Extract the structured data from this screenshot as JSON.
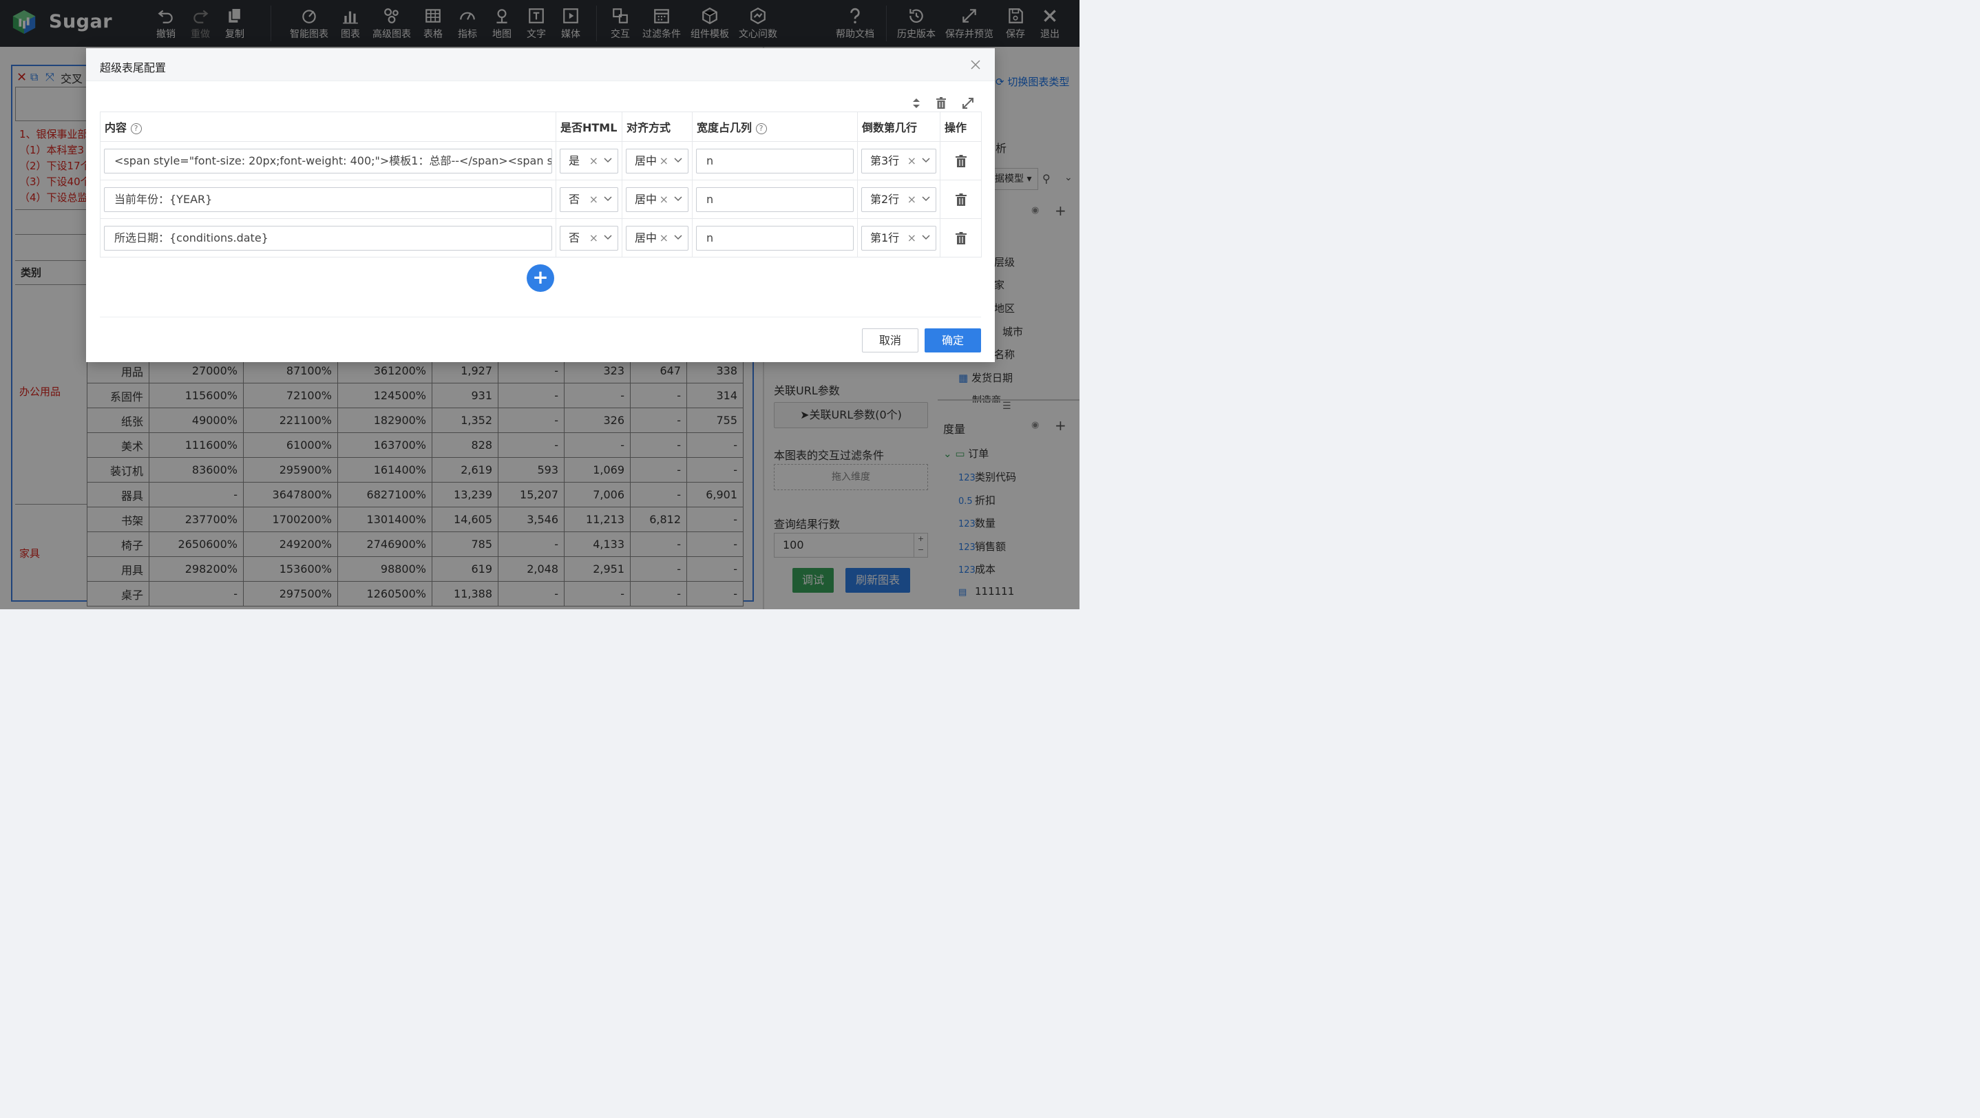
{
  "app": {
    "name": "Sugar"
  },
  "toolbar": {
    "items": [
      {
        "label": "撤销"
      },
      {
        "label": "重做"
      },
      {
        "label": "复制"
      },
      {
        "label": "智能图表"
      },
      {
        "label": "图表"
      },
      {
        "label": "高级图表"
      },
      {
        "label": "表格"
      },
      {
        "label": "指标"
      },
      {
        "label": "地图"
      },
      {
        "label": "文字"
      },
      {
        "label": "媒体"
      },
      {
        "label": "交互"
      },
      {
        "label": "过滤条件"
      },
      {
        "label": "组件模板"
      },
      {
        "label": "文心问数"
      },
      {
        "label": "帮助文档"
      },
      {
        "label": "历史版本"
      },
      {
        "label": "保存并预览"
      },
      {
        "label": "保存"
      },
      {
        "label": "退出"
      }
    ]
  },
  "background": {
    "panel_title": "交叉",
    "left_notes": [
      "1、银保事业部",
      "（1）本科室3",
      "（2）下设17个",
      "（3）下设40个",
      "（4）下设总监"
    ],
    "category_header": "类别",
    "categories": [
      "办公用品",
      "家具"
    ],
    "table": {
      "rows": [
        [
          "用品",
          "27000%",
          "87100%",
          "361200%",
          "1,927",
          "-",
          "323",
          "647",
          "338"
        ],
        [
          "系固件",
          "115600%",
          "72100%",
          "124500%",
          "931",
          "-",
          "-",
          "-",
          "314"
        ],
        [
          "纸张",
          "49000%",
          "221100%",
          "182900%",
          "1,352",
          "-",
          "326",
          "-",
          "755"
        ],
        [
          "美术",
          "111600%",
          "61000%",
          "163700%",
          "828",
          "-",
          "-",
          "-",
          "-"
        ],
        [
          "装订机",
          "83600%",
          "295900%",
          "161400%",
          "2,619",
          "593",
          "1,069",
          "-",
          "-"
        ],
        [
          "器具",
          "-",
          "3647800%",
          "6827100%",
          "13,239",
          "15,207",
          "7,006",
          "-",
          "6,901"
        ],
        [
          "书架",
          "237700%",
          "1700200%",
          "1301400%",
          "14,605",
          "3,546",
          "11,213",
          "6,812",
          "-"
        ],
        [
          "椅子",
          "2650600%",
          "249200%",
          "2746900%",
          "785",
          "-",
          "4,133",
          "-",
          "-"
        ],
        [
          "用具",
          "298200%",
          "153600%",
          "98800%",
          "619",
          "2,048",
          "2,951",
          "-",
          "-"
        ],
        [
          "桌子",
          "-",
          "297500%",
          "1260500%",
          "11,388",
          "-",
          "-",
          "-",
          "-"
        ]
      ]
    },
    "right_panel": {
      "switch_chart_type": "切换图表类型",
      "analysis_fragment": "析",
      "model_select": "据模型",
      "dim_items": [
        "层级",
        "家",
        "地区",
        "城市",
        "名称",
        "发货日期",
        "制造商"
      ],
      "related_url_label": "关联URL参数",
      "related_url_button": "关联URL参数(0个)",
      "interaction_filter_label": "本图表的交互过滤条件",
      "drop_dimension": "拖入维度",
      "result_rows_label": "查询结果行数",
      "result_rows_value": "100",
      "debug_button": "调试",
      "refresh_button": "刷新图表",
      "measure_label": "度量",
      "measure_folder": "订单",
      "measure_items": [
        {
          "type": "123",
          "name": "类别代码"
        },
        {
          "type": "0.5",
          "name": "折扣"
        },
        {
          "type": "123",
          "name": "数量"
        },
        {
          "type": "123",
          "name": "销售额"
        },
        {
          "type": "123",
          "name": "成本"
        },
        {
          "type": "",
          "name": "111111"
        }
      ]
    }
  },
  "modal": {
    "title": "超级表尾配置",
    "columns": [
      "内容",
      "是否HTML",
      "对齐方式",
      "宽度占几列",
      "倒数第几行",
      "操作"
    ],
    "rows": [
      {
        "content": "<span style=\"font-size: 20px;font-weight: 400;\">模板1：总部--</span><span st",
        "html": "是",
        "align": "居中",
        "width": "n",
        "row": "第3行"
      },
      {
        "content": "当前年份：{YEAR}",
        "html": "否",
        "align": "居中",
        "width": "n",
        "row": "第2行"
      },
      {
        "content": "所选日期：{conditions.date}",
        "html": "否",
        "align": "居中",
        "width": "n",
        "row": "第1行"
      }
    ],
    "add_symbol": "+",
    "cancel": "取消",
    "confirm": "确定"
  }
}
